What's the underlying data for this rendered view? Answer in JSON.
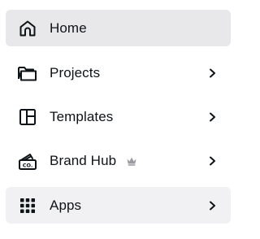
{
  "nav": {
    "items": [
      {
        "label": "Home",
        "icon": "home-icon",
        "state": "active",
        "has_chevron": false
      },
      {
        "label": "Projects",
        "icon": "folder-icon",
        "state": "default",
        "has_chevron": true
      },
      {
        "label": "Templates",
        "icon": "templates-icon",
        "state": "default",
        "has_chevron": true
      },
      {
        "label": "Brand Hub",
        "icon": "brand-hub-icon",
        "state": "default",
        "has_chevron": true,
        "badge_icon": "crown-icon"
      },
      {
        "label": "Apps",
        "icon": "apps-grid-icon",
        "state": "hover",
        "has_chevron": true
      }
    ]
  },
  "colors": {
    "text": "#0e1318",
    "active_bg": "#e8e8ea",
    "hover_bg": "#f1f1f3",
    "crown": "#9a9aa0"
  }
}
